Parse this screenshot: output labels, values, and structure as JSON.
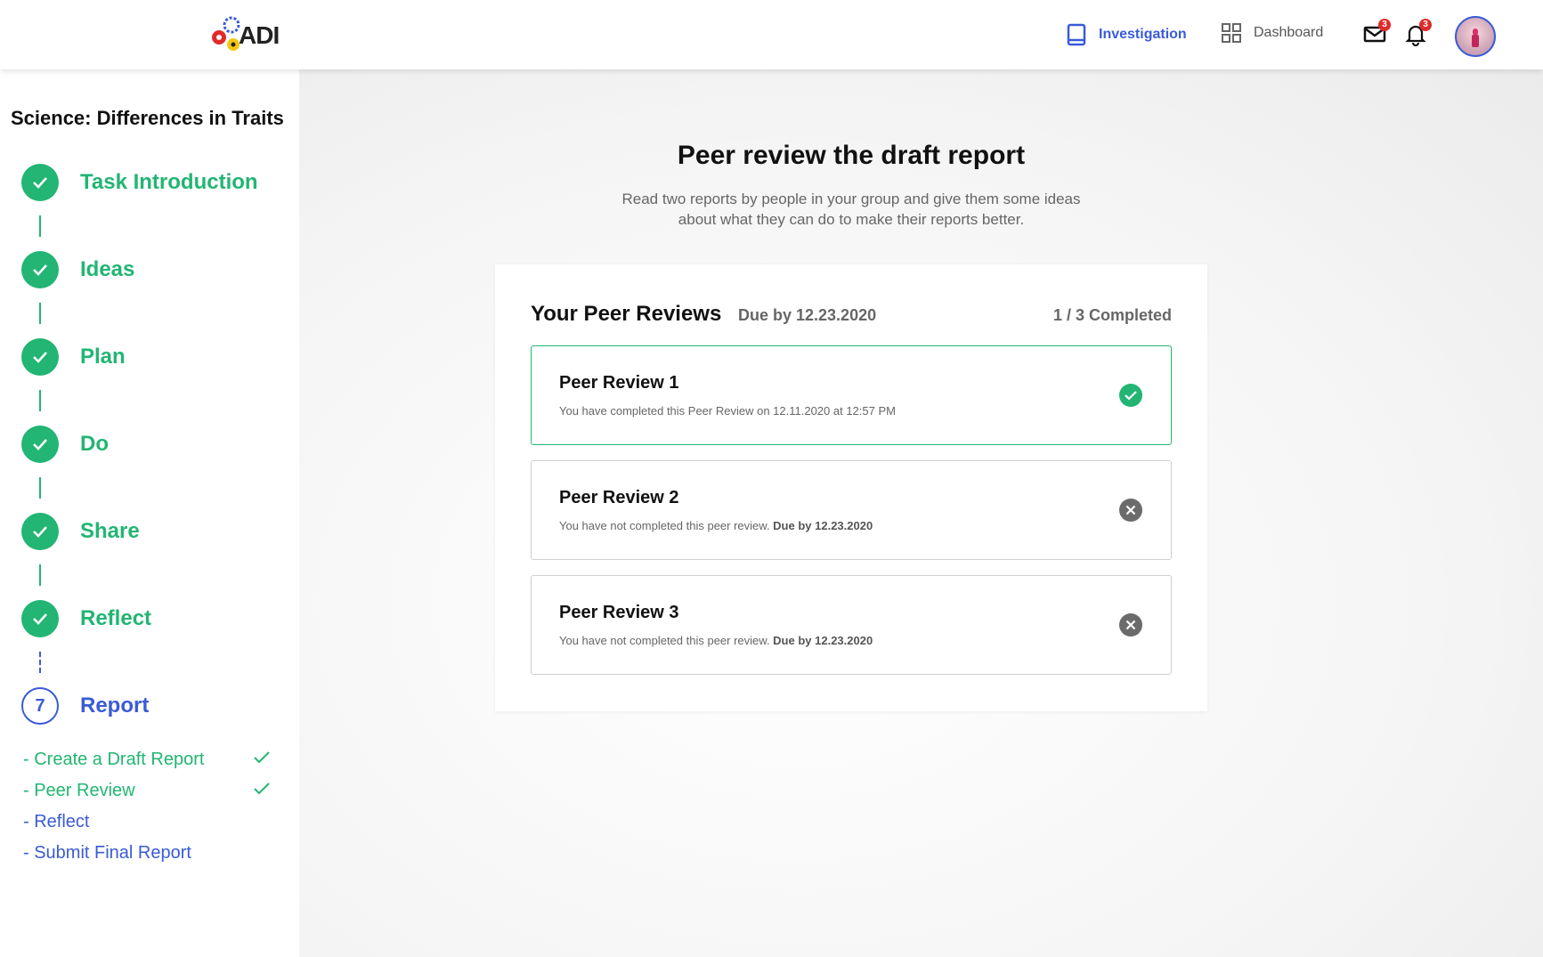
{
  "header": {
    "logo_text": "ADI",
    "nav": [
      {
        "label": "Investigation",
        "icon": "book-icon",
        "active": true
      },
      {
        "label": "Dashboard",
        "icon": "grid-icon",
        "active": false
      }
    ],
    "mail_badge": "3",
    "bell_badge": "3"
  },
  "sidebar": {
    "course_title": "Science: Differences in Traits",
    "steps": [
      {
        "label": "Task Introduction",
        "status": "complete"
      },
      {
        "label": "Ideas",
        "status": "complete"
      },
      {
        "label": "Plan",
        "status": "complete"
      },
      {
        "label": "Do",
        "status": "complete"
      },
      {
        "label": "Share",
        "status": "complete"
      },
      {
        "label": "Reflect",
        "status": "complete"
      },
      {
        "label": "Report",
        "status": "current",
        "number": "7"
      }
    ],
    "substeps": [
      {
        "label": "- Create a Draft Report",
        "done": true
      },
      {
        "label": "- Peer Review",
        "done": true
      },
      {
        "label": "- Reflect",
        "done": false
      },
      {
        "label": "- Submit Final Report",
        "done": false
      }
    ]
  },
  "main": {
    "title": "Peer review the draft report",
    "description_line1": "Read two reports by people in your group and give them some ideas",
    "description_line2": "about what they can do to make their reports better.",
    "card": {
      "title": "Your Peer Reviews",
      "due": "Due by 12.23.2020",
      "completed": "1 / 3 Completed",
      "reviews": [
        {
          "name": "Peer Review 1",
          "status_text": "You have completed this Peer Review on 12.11.2020 at 12:57 PM",
          "due_text": "",
          "complete": true
        },
        {
          "name": "Peer Review 2",
          "status_text": "You have not completed this peer review. ",
          "due_text": "Due by 12.23.2020",
          "complete": false
        },
        {
          "name": "Peer Review 3",
          "status_text": "You have not completed this peer review. ",
          "due_text": "Due by 12.23.2020",
          "complete": false
        }
      ]
    }
  },
  "colors": {
    "green": "#22b573",
    "blue": "#3a5bd6",
    "badge": "#e02b2b"
  }
}
